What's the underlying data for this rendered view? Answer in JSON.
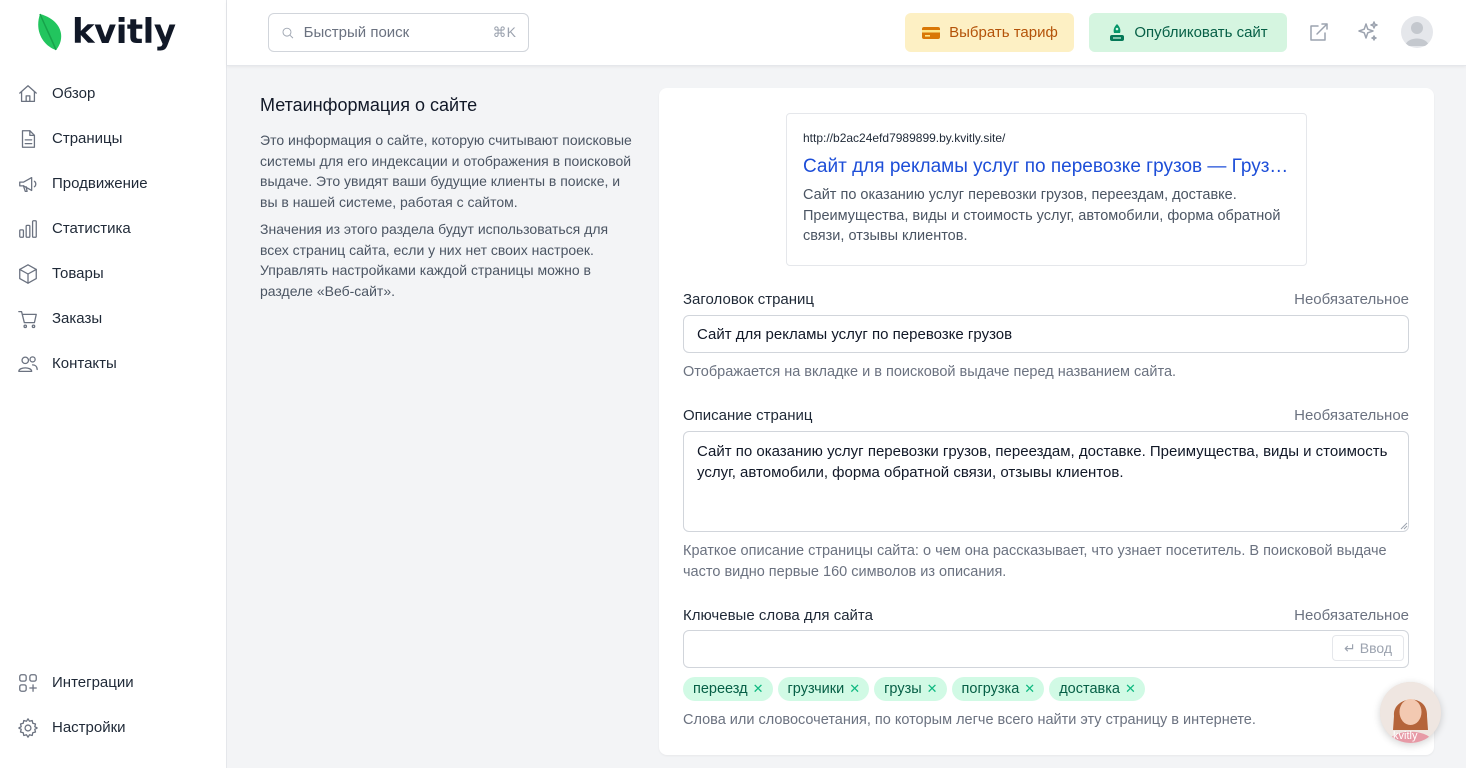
{
  "app": {
    "logo_text": "kvitly",
    "brand_color": "#22c55e"
  },
  "sidebar": {
    "items": [
      {
        "label": "Обзор",
        "icon": "home-icon"
      },
      {
        "label": "Страницы",
        "icon": "document-icon"
      },
      {
        "label": "Продвижение",
        "icon": "megaphone-icon"
      },
      {
        "label": "Статистика",
        "icon": "bar-chart-icon"
      },
      {
        "label": "Товары",
        "icon": "box-icon"
      },
      {
        "label": "Заказы",
        "icon": "cart-icon"
      },
      {
        "label": "Контакты",
        "icon": "users-icon"
      }
    ],
    "bottom_items": [
      {
        "label": "Интеграции",
        "icon": "integrations-icon"
      },
      {
        "label": "Настройки",
        "icon": "gear-icon"
      }
    ]
  },
  "header": {
    "search_placeholder": "Быстрый поиск",
    "search_shortcut": "⌘K",
    "tariff_label": "Выбрать тариф",
    "publish_label": "Опубликовать сайт"
  },
  "section": {
    "title": "Метаинформация о сайте",
    "paragraph1": "Это информация о сайте, которую считывают поисковые системы для его индексации и отображения в поисковой выдаче. Это увидят ваши будущие клиенты в поиске, и вы в нашей системе, работая с сайтом.",
    "paragraph2": "Значения из этого раздела будут использоваться для всех страниц сайта, если у них нет своих настроек. Управлять настройками каждой страницы можно в разделе «Веб-сайт»."
  },
  "preview": {
    "url": "http://b2ac24efd7989899.by.kvitly.site/",
    "title": "Сайт для рекламы услуг по перевозке грузов — Грузоперевозки",
    "description": "Сайт по оказанию услуг перевозки грузов, переездам, доставке. Преимущества, виды и стоимость услуг, автомобили, форма обратной связи, отзывы клиентов."
  },
  "fields": {
    "optional_label": "Необязательное",
    "page_title": {
      "label": "Заголовок страниц",
      "value": "Сайт для рекламы услуг по перевозке грузов",
      "hint": "Отображается на вкладке и в поисковой выдаче перед названием сайта."
    },
    "page_description": {
      "label": "Описание страниц",
      "value": "Сайт по оказанию услуг перевозки грузов, переездам, доставке. Преимущества, виды и стоимость услуг, автомобили, форма обратной связи, отзывы клиентов.",
      "hint": "Краткое описание страницы сайта: о чем она рассказывает, что узнает посетитель. В поисковой выдаче часто видно первые 160 символов из описания."
    },
    "keywords": {
      "label": "Ключевые слова для сайта",
      "value": "",
      "enter_label": "Ввод",
      "tags": [
        "переезд",
        "грузчики",
        "грузы",
        "погрузка",
        "доставка"
      ],
      "hint": "Слова или словосочетания, по которым легче всего найти эту страницу в интернете."
    }
  },
  "chat": {
    "badge_text": "kvitly"
  }
}
